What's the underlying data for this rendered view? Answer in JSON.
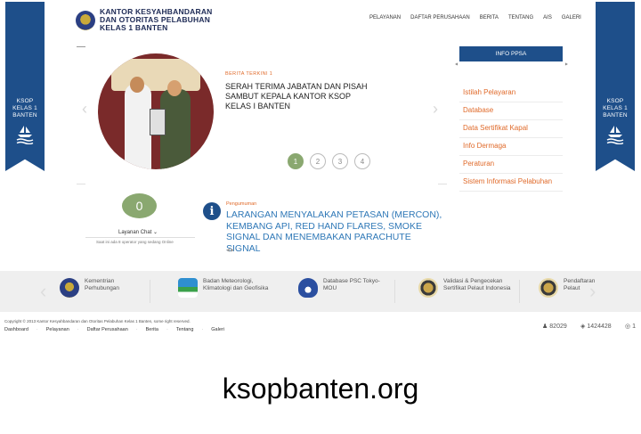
{
  "ribbon": {
    "line1": "KSOP",
    "line2": "KELAS 1",
    "line3": "BANTEN",
    "icon": "ship-wave-icon"
  },
  "header": {
    "logo_icon": "ministry-emblem-icon",
    "title_line1": "KANTOR KESYAHBANDARAN",
    "title_line2": "DAN OTORITAS PELABUHAN",
    "title_line3": "KELAS 1 BANTEN",
    "nav": [
      "PELAYANAN",
      "DAFTAR PERUSAHAAN",
      "BERITA",
      "TENTANG",
      "AIS",
      "GALERI"
    ]
  },
  "hero": {
    "kicker": "BERITA TERKINI 1",
    "title": "SERAH TERIMA JABATAN DAN PISAH SAMBUT KEPALA KANTOR KSOP KELAS I BANTEN",
    "pages": [
      "1",
      "2",
      "3",
      "4"
    ],
    "active_page": 1
  },
  "info": {
    "heading": "INFO PPSA",
    "items": [
      "Istilah Pelayaran",
      "Database",
      "Data Sertifikat Kapal",
      "Info Dermaga",
      "Peraturan",
      "Sistem Informasi Pelabuhan"
    ]
  },
  "chat": {
    "count": "0",
    "label": "Layanan Chat",
    "status": "Saat ini ada 8 operator yang sedang Online"
  },
  "announcement": {
    "kicker": "Pengumuman",
    "title": "LARANGAN MENYALAKAN PETASAN (MERCON), KEMBANG API, RED HAND FLARES, SMOKE SIGNAL DAN MENEMBAKAN PARACHUTE SIGNAL",
    "nav": "◀ ▶"
  },
  "partners": [
    {
      "icon": "kemenhub-logo-icon",
      "name": "Kementrian Perhubungan"
    },
    {
      "icon": "bmkg-logo-icon",
      "name": "Badan Meteorologi, Klimatologi dan Geofisika"
    },
    {
      "icon": "tokyo-mou-logo-icon",
      "name": "Database PSC Tokyo-MOU"
    },
    {
      "icon": "seafarer-emblem-icon",
      "name": "Validasi & Pengecekan Sertifikat Pelaut Indonesia"
    },
    {
      "icon": "seafarer-emblem-icon",
      "name": "Pendaftaran Pelaut"
    }
  ],
  "footer": {
    "copyright": "Copyright © 2013 Kantor Kesyahbandaran dan Otoritas Pelabuhan Kelas 1 Banten, some right reserved.",
    "nav": [
      "Dashboard",
      "Pelayanan",
      "Daftar Perusahaan",
      "Berita",
      "Tentang",
      "Galeri"
    ],
    "stats": [
      {
        "icon": "user-icon",
        "value": "82029"
      },
      {
        "icon": "eye-icon",
        "value": "1424428"
      },
      {
        "icon": "online-icon",
        "value": "1"
      }
    ]
  },
  "caption": "ksopbanten.org",
  "colors": {
    "brand_blue": "#1e4f8a",
    "accent_orange": "#e06a2a",
    "link_blue": "#2f78b7",
    "green": "#8aa870"
  }
}
